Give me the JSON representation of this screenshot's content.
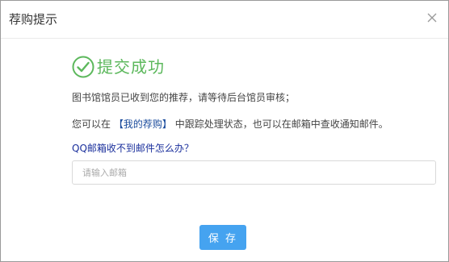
{
  "dialog": {
    "title": "荐购提示",
    "close_icon": "close-icon"
  },
  "success": {
    "icon": "check-circle-icon",
    "text": "提交成功",
    "color": "#5cb85c"
  },
  "notice": {
    "line1": "图书馆馆员已收到您的推荐，请等待后台馆员审核；",
    "line2_prefix": "您可以在",
    "line2_link": "【我的荐购】",
    "line2_suffix": "中跟踪处理状态，也可以在邮箱中查收通知邮件。"
  },
  "qq_help": {
    "text": "QQ邮箱收不到邮件怎么办？"
  },
  "email": {
    "placeholder": "请输入邮箱",
    "value": ""
  },
  "actions": {
    "save_label": "保 存",
    "accent": "#45a3f0"
  }
}
